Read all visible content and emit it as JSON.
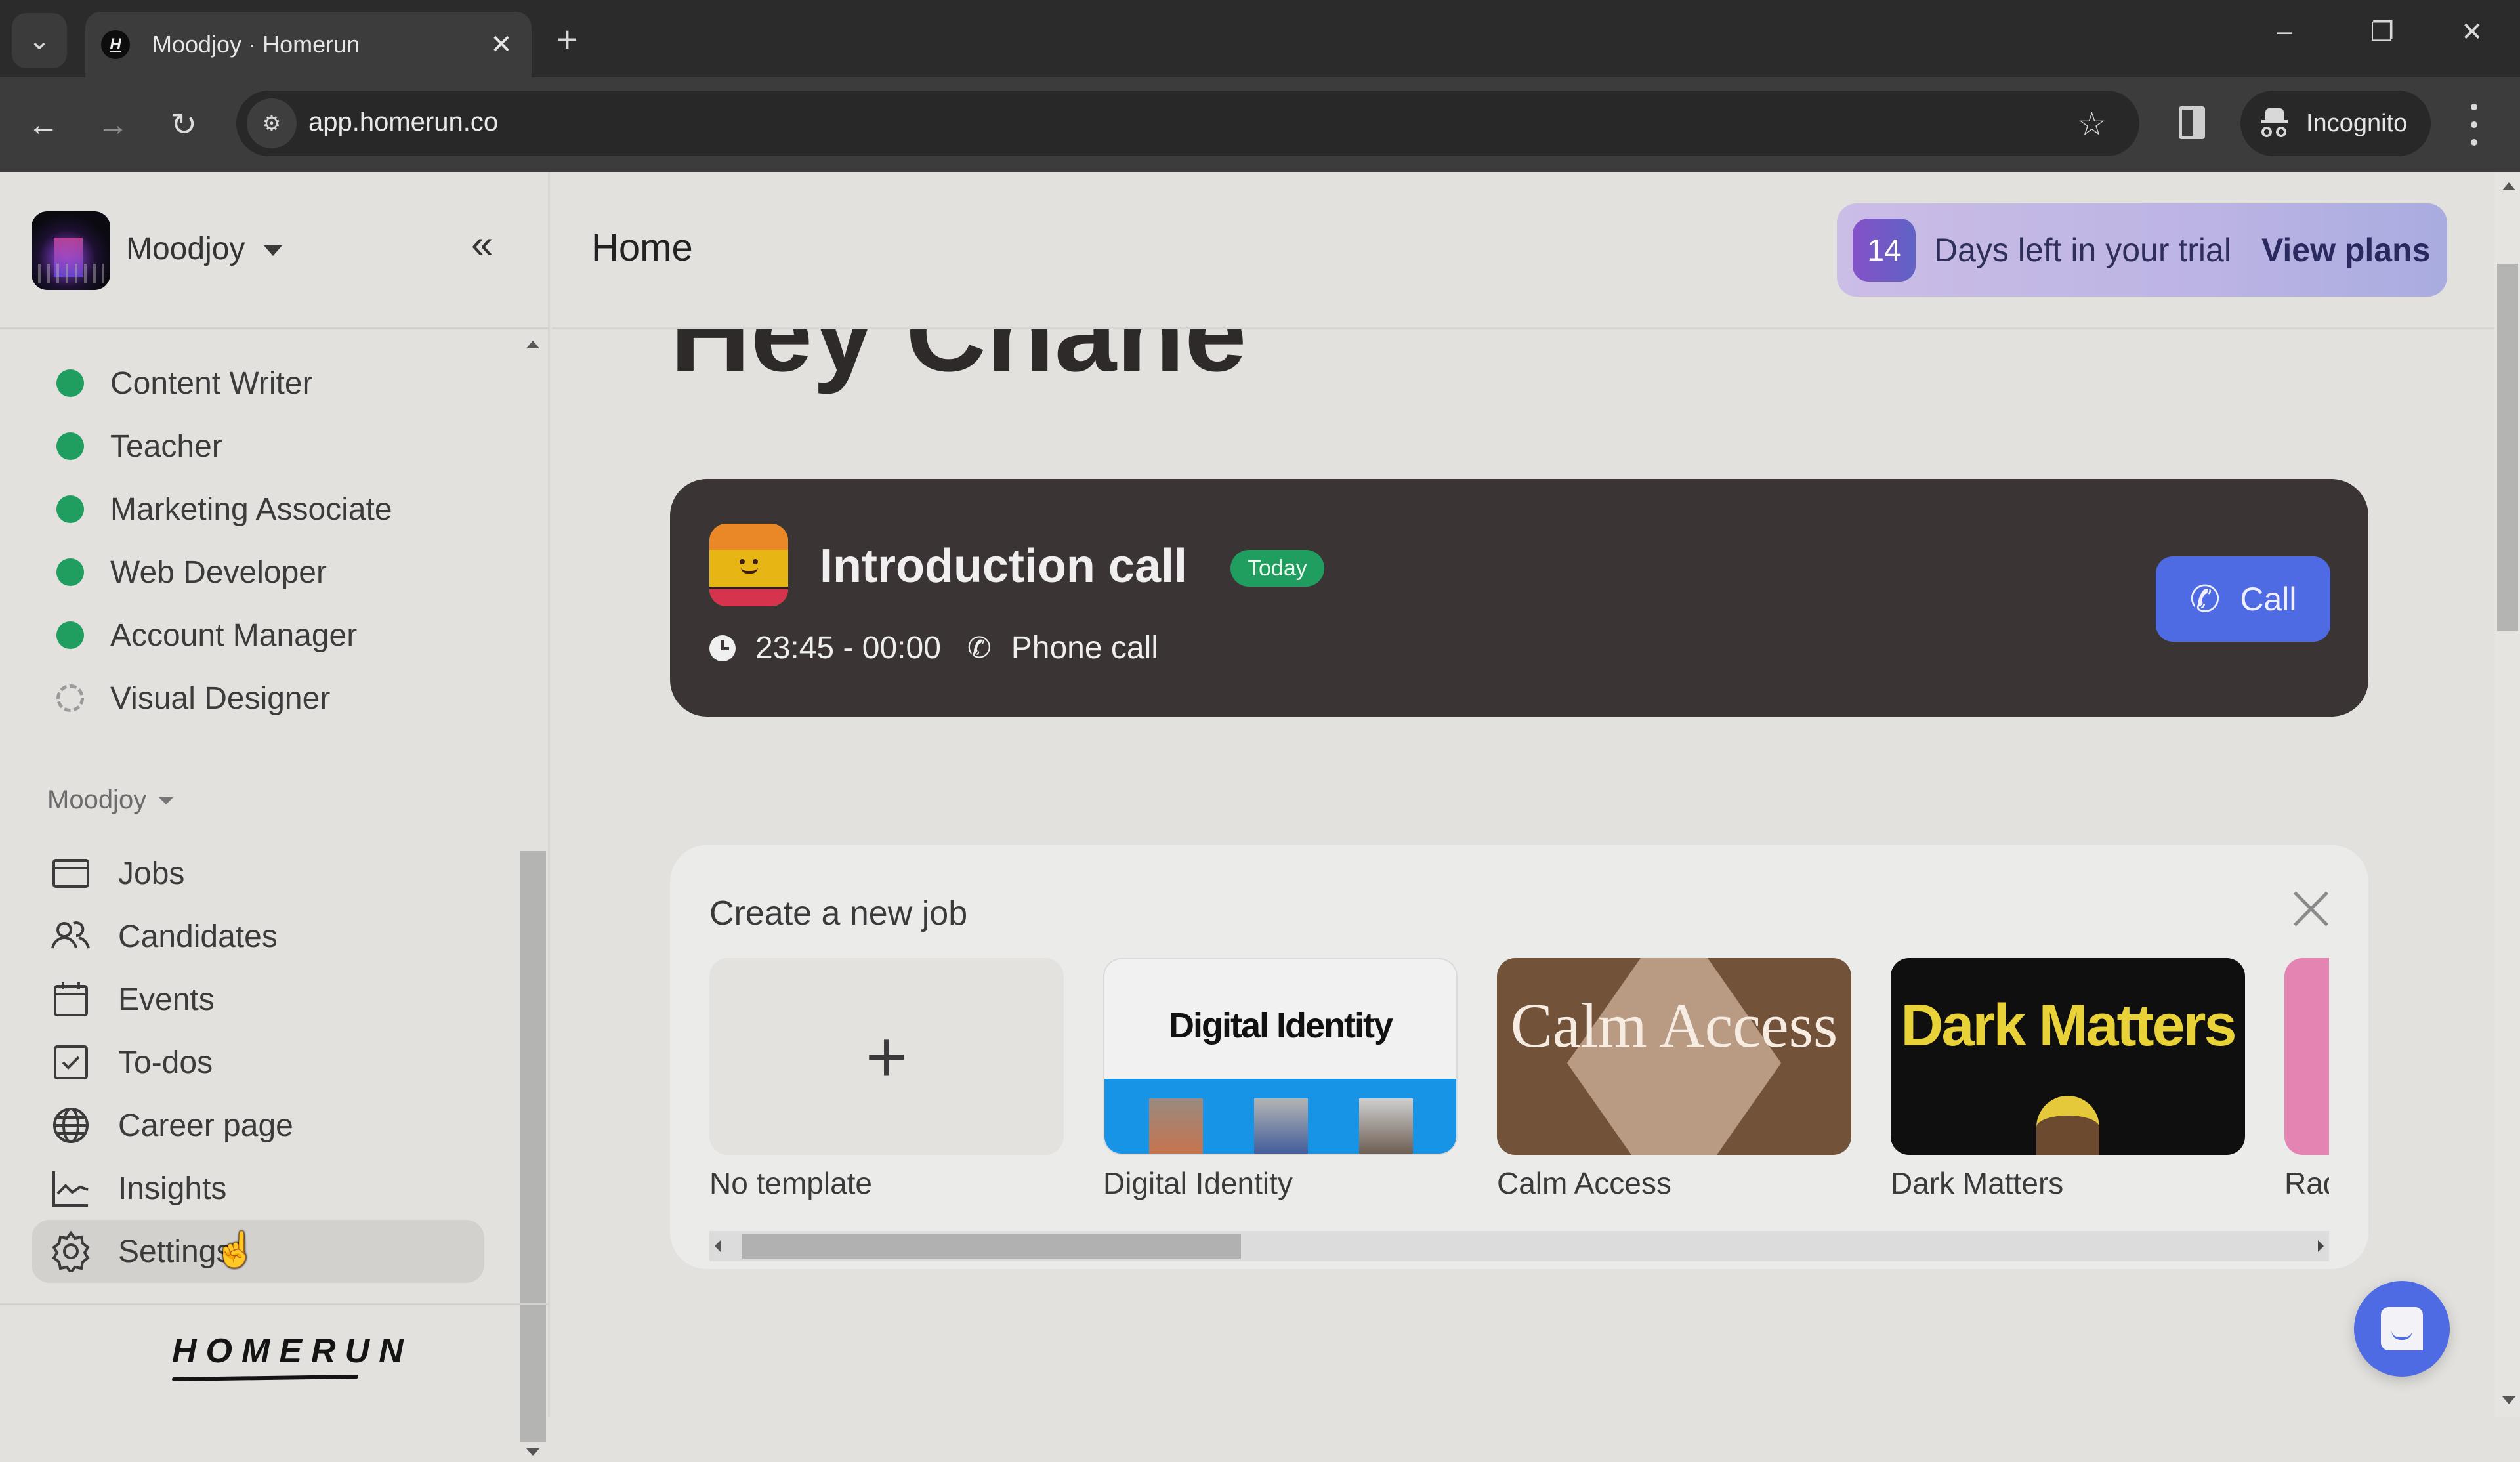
{
  "browser": {
    "tab_title": "Moodjoy · Homerun",
    "tab_favicon": "H",
    "url": "app.homerun.co",
    "profile_label": "Incognito",
    "icons": {
      "tab_search": "⌄",
      "close_tab": "✕",
      "new_tab": "+",
      "back": "←",
      "forward": "→",
      "reload": "↻",
      "site_info": "⚙",
      "bookmark": "☆",
      "minimize": "–",
      "restore": "❐",
      "close_window": "✕"
    }
  },
  "sidebar": {
    "org_name": "Moodjoy",
    "collapse_icon": "«",
    "jobs": [
      {
        "label": "Content Writer",
        "status": "published"
      },
      {
        "label": "Teacher",
        "status": "published"
      },
      {
        "label": "Marketing Associate",
        "status": "published"
      },
      {
        "label": "Web Developer",
        "status": "published"
      },
      {
        "label": "Account Manager",
        "status": "published"
      },
      {
        "label": "Visual Designer",
        "status": "draft"
      }
    ],
    "section_label": "Moodjoy",
    "nav": [
      {
        "label": "Jobs",
        "icon": "jobs-icon"
      },
      {
        "label": "Candidates",
        "icon": "candidates-icon"
      },
      {
        "label": "Events",
        "icon": "calendar-icon"
      },
      {
        "label": "To-dos",
        "icon": "checkbox-icon"
      },
      {
        "label": "Career page",
        "icon": "globe-icon"
      },
      {
        "label": "Insights",
        "icon": "chart-icon"
      },
      {
        "label": "Settings",
        "icon": "gear-icon",
        "active": true
      }
    ],
    "brand": "HOMERUN"
  },
  "header": {
    "title": "Home",
    "trial": {
      "days_left": "14",
      "text": "Days left in your trial",
      "link": "View plans"
    }
  },
  "greeting": "Hey Chane",
  "event": {
    "title": "Introduction call",
    "badge": "Today",
    "time": "23:45 - 00:00",
    "type": "Phone call",
    "call_label": "Call",
    "phone_icon": "✆"
  },
  "create_job": {
    "title": "Create a new job",
    "templates": [
      {
        "label": "No template",
        "thumb_text": "+"
      },
      {
        "label": "Digital Identity",
        "thumb_text": "Digital Identity"
      },
      {
        "label": "Calm Access",
        "thumb_text": "Calm Access"
      },
      {
        "label": "Dark Matters",
        "thumb_text": "Dark Matters"
      },
      {
        "label": "Rad"
      }
    ]
  },
  "colors": {
    "accent": "#4f6be3",
    "published": "#1f9e60",
    "event_card": "#3a3434",
    "trial_gradient_start": "#cbbde6",
    "trial_gradient_end": "#a9ace0"
  }
}
